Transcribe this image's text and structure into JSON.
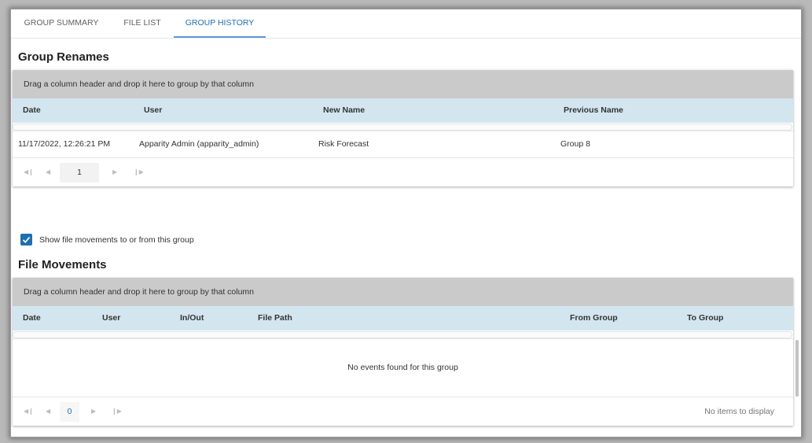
{
  "tabs": [
    {
      "label": "GROUP SUMMARY",
      "active": false
    },
    {
      "label": "FILE LIST",
      "active": false
    },
    {
      "label": "GROUP HISTORY",
      "active": true
    }
  ],
  "renames": {
    "title": "Group Renames",
    "group_panel_hint": "Drag a column header and drop it here to group by that column",
    "columns": [
      "Date",
      "User",
      "New Name",
      "Previous Name"
    ],
    "rows": [
      {
        "date": "11/17/2022, 12:26:21 PM",
        "user": "Apparity Admin (apparity_admin)",
        "new_name": "Risk Forecast",
        "previous_name": "Group 8"
      }
    ],
    "pager": {
      "current_page": "1"
    }
  },
  "movements_toggle": {
    "checked": true,
    "label": "Show file movements to or from this group"
  },
  "movements": {
    "title": "File Movements",
    "group_panel_hint": "Drag a column header and drop it here to group by that column",
    "columns": [
      "Date",
      "User",
      "In/Out",
      "File Path",
      "From Group",
      "To Group"
    ],
    "empty_message": "No events found for this group",
    "pager": {
      "current_page": "0",
      "info": "No items to display"
    }
  },
  "colors": {
    "accent": "#1f6fb0",
    "header_bg": "#d3e6f0",
    "group_panel_bg": "#cacaca"
  },
  "icons": {
    "pager_first": "first-page-icon",
    "pager_prev": "prev-page-icon",
    "pager_next": "next-page-icon",
    "pager_last": "last-page-icon",
    "checkbox": "checkmark-icon"
  }
}
